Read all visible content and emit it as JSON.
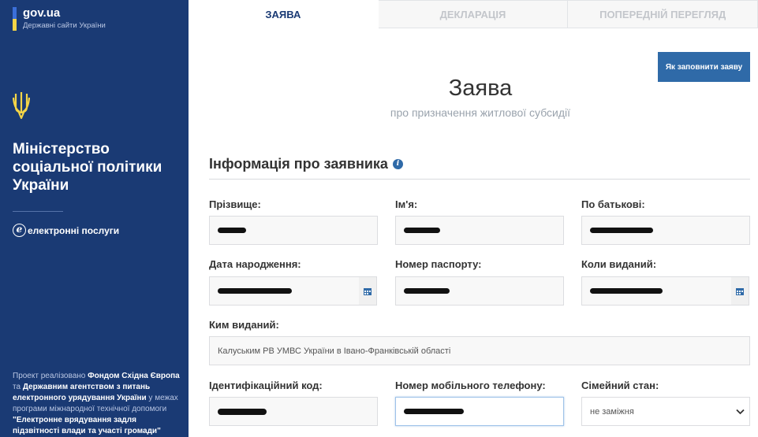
{
  "sidebar": {
    "gov_name": "gov.ua",
    "gov_sub": "Державні сайти України",
    "ministry": "Міністерство соціальної політики України",
    "eservices": "електронні послуги",
    "e_letter": "e",
    "project": {
      "p1": "Проект реалізовано ",
      "b1": "Фондом Східна Європа",
      "p2": " та ",
      "b2": "Державним агентством з питань електронного урядування України",
      "p3": " у межах програми міжнародної технічної допомоги ",
      "b3": "\"Електронне врядування задля підзвітності влади та участі громади\""
    }
  },
  "tabs": [
    {
      "label": "Заява",
      "active": true
    },
    {
      "label": "Декларація",
      "active": false
    },
    {
      "label": "Попередній перегляд",
      "active": false
    }
  ],
  "help_button": "Як заповнити заяву",
  "page_title": "Заява",
  "page_subtitle": "про призначення житлової субсидії",
  "section_title": "Інформація про заявника",
  "form": {
    "surname_label": "Прізвище:",
    "name_label": "Ім'я:",
    "patronymic_label": "По батькові:",
    "birth_label": "Дата народження:",
    "passport_label": "Номер паспорту:",
    "issued_when_label": "Коли виданий:",
    "issued_by_label": "Ким виданий:",
    "issued_by_value": "Калуським РВ УМВС України в Івано-Франківській області",
    "tax_label": "Ідентифікаційний код:",
    "phone_label": "Номер мобільного телефону:",
    "family_label": "Сімейний стан:",
    "family_value": "не заміжня"
  },
  "colors": {
    "sidebar_bg": "#1a3a74",
    "accent": "#2f6aa8",
    "flag_blue": "#3b6fd9",
    "flag_yellow": "#f5d547"
  }
}
